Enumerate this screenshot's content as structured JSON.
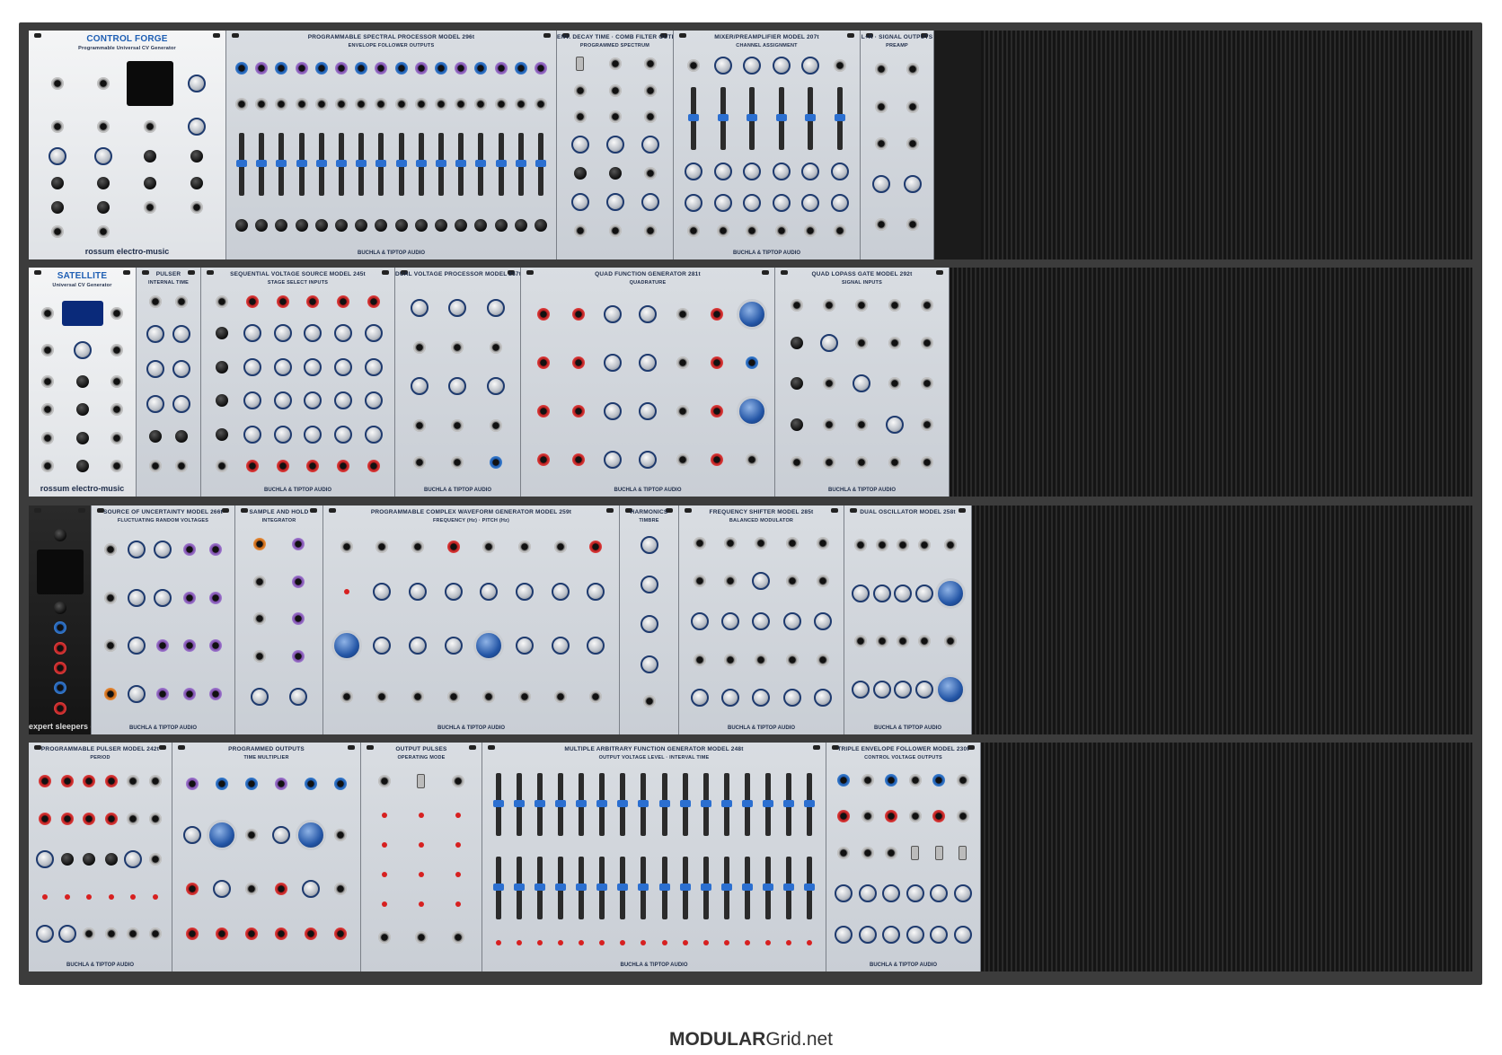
{
  "footer": {
    "brand_bold": "MODULAR",
    "brand_rest": "Grid.net"
  },
  "rows": [
    {
      "modules": [
        {
          "title": "CONTROL FORGE",
          "subtitle": "Programmable Universal CV Generator",
          "foot": "rossum electro-music",
          "style": "white",
          "cols": 4,
          "components": [
            "jack",
            "jack",
            "screen",
            "knob",
            "jack",
            "jack",
            "jack",
            "knob",
            "knob",
            "knob",
            "btn",
            "btn",
            "btn",
            "btn",
            "btn",
            "btn",
            "btn",
            "btn",
            "jack",
            "jack",
            "jack",
            "jack"
          ]
        },
        {
          "title": "PROGRAMMABLE SPECTRAL PROCESSOR MODEL 296t",
          "subtitle": "ENVELOPE FOLLOWER OUTPUTS",
          "foot": "BUCHLA & TIPTOP AUDIO",
          "style": "grey",
          "cols": 16,
          "components": [
            "jack.blue",
            "jack.purple",
            "jack.blue",
            "jack.purple",
            "jack.blue",
            "jack.purple",
            "jack.blue",
            "jack.purple",
            "jack.blue",
            "jack.purple",
            "jack.blue",
            "jack.purple",
            "jack.blue",
            "jack.purple",
            "jack.blue",
            "jack.purple",
            "jack",
            "jack",
            "jack",
            "jack",
            "jack",
            "jack",
            "jack",
            "jack",
            "jack",
            "jack",
            "jack",
            "jack",
            "jack",
            "jack",
            "jack",
            "jack",
            "slider",
            "slider",
            "slider",
            "slider",
            "slider",
            "slider",
            "slider",
            "slider",
            "slider",
            "slider",
            "slider",
            "slider",
            "slider",
            "slider",
            "slider",
            "slider",
            "btn",
            "btn",
            "btn",
            "btn",
            "btn",
            "btn",
            "btn",
            "btn",
            "btn",
            "btn",
            "btn",
            "btn",
            "btn",
            "btn",
            "btn",
            "btn"
          ]
        },
        {
          "title": "ENV. DECAY TIME · COMB FILTER OUTPUTS",
          "subtitle": "PROGRAMMED SPECTRUM",
          "foot": "",
          "style": "grey",
          "cols": 3,
          "components": [
            "sw",
            "jack",
            "jack",
            "jack",
            "jack",
            "jack",
            "jack",
            "jack",
            "jack",
            "knob",
            "knob",
            "knob",
            "btn",
            "btn",
            "jack",
            "knob",
            "knob",
            "knob",
            "jack",
            "jack",
            "jack"
          ]
        },
        {
          "title": "MIXER/PREAMPLIFIER MODEL 207t",
          "subtitle": "CHANNEL ASSIGNMENT",
          "foot": "BUCHLA & TIPTOP AUDIO",
          "style": "grey",
          "cols": 6,
          "components": [
            "jack",
            "knob",
            "knob",
            "knob",
            "knob",
            "jack",
            "slider",
            "slider",
            "slider",
            "slider",
            "slider",
            "slider",
            "knob",
            "knob",
            "knob",
            "knob",
            "knob",
            "knob",
            "knob",
            "knob",
            "knob",
            "knob",
            "knob",
            "knob",
            "jack",
            "jack",
            "jack",
            "jack",
            "jack",
            "jack"
          ]
        },
        {
          "title": "L+R · SIGNAL OUTPUTS",
          "subtitle": "PREAMP",
          "foot": "",
          "style": "grey",
          "cols": 2,
          "components": [
            "jack",
            "jack",
            "jack",
            "jack",
            "jack",
            "jack",
            "knob",
            "knob",
            "jack",
            "jack"
          ]
        }
      ]
    },
    {
      "modules": [
        {
          "title": "SATELLITE",
          "subtitle": "Universal CV Generator",
          "foot": "rossum electro-music",
          "style": "white",
          "cols": 3,
          "components": [
            "jack",
            "screen.small",
            "jack",
            "jack",
            "knob",
            "jack",
            "jack",
            "btn",
            "jack",
            "jack",
            "btn",
            "jack",
            "jack",
            "btn",
            "jack",
            "jack",
            "btn",
            "jack"
          ]
        },
        {
          "title": "PULSER",
          "subtitle": "INTERNAL TIME",
          "foot": "",
          "style": "grey",
          "cols": 2,
          "components": [
            "jack",
            "jack",
            "knob",
            "knob",
            "knob",
            "knob",
            "knob",
            "knob",
            "btn",
            "btn",
            "jack",
            "jack"
          ]
        },
        {
          "title": "SEQUENTIAL VOLTAGE SOURCE MODEL 245t",
          "subtitle": "STAGE SELECT INPUTS",
          "foot": "BUCHLA & TIPTOP AUDIO",
          "style": "grey",
          "cols": 6,
          "components": [
            "jack",
            "jack.red",
            "jack.red",
            "jack.red",
            "jack.red",
            "jack.red",
            "btn",
            "knob",
            "knob",
            "knob",
            "knob",
            "knob",
            "btn",
            "knob",
            "knob",
            "knob",
            "knob",
            "knob",
            "btn",
            "knob",
            "knob",
            "knob",
            "knob",
            "knob",
            "btn",
            "knob",
            "knob",
            "knob",
            "knob",
            "knob",
            "jack",
            "jack.red",
            "jack.red",
            "jack.red",
            "jack.red",
            "jack.red"
          ]
        },
        {
          "title": "DUAL VOLTAGE PROCESSOR MODEL 257t",
          "subtitle": "",
          "foot": "BUCHLA & TIPTOP AUDIO",
          "style": "grey",
          "cols": 3,
          "components": [
            "knob",
            "knob",
            "knob",
            "jack",
            "jack",
            "jack",
            "knob",
            "knob",
            "knob",
            "jack",
            "jack",
            "jack",
            "jack",
            "jack",
            "jack.blue"
          ]
        },
        {
          "title": "QUAD FUNCTION GENERATOR 281t",
          "subtitle": "QUADRATURE",
          "foot": "BUCHLA & TIPTOP AUDIO",
          "style": "grey",
          "cols": 7,
          "components": [
            "jack.red",
            "jack.red",
            "knob",
            "knob",
            "jack",
            "jack.red",
            "knob.big",
            "jack.red",
            "jack.red",
            "knob",
            "knob",
            "jack",
            "jack.red",
            "jack.blue",
            "jack.red",
            "jack.red",
            "knob",
            "knob",
            "jack",
            "jack.red",
            "knob.big",
            "jack.red",
            "jack.red",
            "knob",
            "knob",
            "jack",
            "jack.red",
            "jack"
          ]
        },
        {
          "title": "QUAD LOPASS GATE MODEL 292t",
          "subtitle": "SIGNAL INPUTS",
          "foot": "BUCHLA & TIPTOP AUDIO",
          "style": "grey",
          "cols": 5,
          "components": [
            "jack",
            "jack",
            "jack",
            "jack",
            "jack",
            "btn",
            "knob",
            "jack",
            "jack",
            "jack",
            "btn",
            "jack",
            "knob",
            "jack",
            "jack",
            "btn",
            "jack",
            "jack",
            "knob",
            "jack",
            "jack",
            "jack",
            "jack",
            "jack",
            "jack"
          ]
        }
      ]
    },
    {
      "modules": [
        {
          "title": "",
          "subtitle": "",
          "foot": "expert sleepers disting",
          "style": "dark",
          "cols": 1,
          "components": [
            "btn",
            "screen",
            "btn",
            "jack.blue",
            "jack.red",
            "jack.red",
            "jack.blue",
            "jack.red"
          ]
        },
        {
          "title": "SOURCE OF UNCERTAINTY MODEL 266t",
          "subtitle": "FLUCTUATING RANDOM VOLTAGES",
          "foot": "BUCHLA & TIPTOP AUDIO",
          "style": "grey",
          "cols": 5,
          "components": [
            "jack",
            "knob",
            "knob",
            "jack.purple",
            "jack.purple",
            "jack",
            "knob",
            "knob",
            "jack.purple",
            "jack.purple",
            "jack",
            "knob",
            "jack.purple",
            "jack.purple",
            "jack.purple",
            "jack.orange",
            "knob",
            "jack.purple",
            "jack.purple",
            "jack.purple"
          ]
        },
        {
          "title": "SAMPLE AND HOLD",
          "subtitle": "INTEGRATOR",
          "foot": "",
          "style": "grey",
          "cols": 2,
          "components": [
            "jack.orange",
            "jack.purple",
            "jack",
            "jack.purple",
            "jack",
            "jack.purple",
            "jack",
            "jack.purple",
            "knob",
            "knob"
          ]
        },
        {
          "title": "PROGRAMMABLE COMPLEX WAVEFORM GENERATOR MODEL 259t",
          "subtitle": "FREQUENCY (Hz) · PITCH (Hz)",
          "foot": "BUCHLA & TIPTOP AUDIO",
          "style": "grey",
          "cols": 8,
          "components": [
            "jack",
            "jack",
            "jack",
            "jack.red",
            "jack",
            "jack",
            "jack",
            "jack.red",
            "led",
            "knob",
            "knob",
            "knob",
            "knob",
            "knob",
            "knob",
            "knob",
            "knob.big",
            "knob",
            "knob",
            "knob",
            "knob.big",
            "knob",
            "knob",
            "knob",
            "jack",
            "jack",
            "jack",
            "jack",
            "jack",
            "jack",
            "jack",
            "jack"
          ]
        },
        {
          "title": "HARMONICS",
          "subtitle": "TIMBRE",
          "foot": "",
          "style": "grey",
          "cols": 1,
          "components": [
            "knob",
            "knob",
            "knob",
            "knob",
            "jack"
          ]
        },
        {
          "title": "FREQUENCY SHIFTER MODEL 285t",
          "subtitle": "BALANCED MODULATOR",
          "foot": "BUCHLA & TIPTOP AUDIO",
          "style": "grey",
          "cols": 5,
          "components": [
            "jack",
            "jack",
            "jack",
            "jack",
            "jack",
            "jack",
            "jack",
            "knob",
            "jack",
            "jack",
            "knob",
            "knob",
            "knob",
            "knob",
            "knob",
            "jack",
            "jack",
            "jack",
            "jack",
            "jack",
            "knob",
            "knob",
            "knob",
            "knob",
            "knob"
          ]
        },
        {
          "title": "DUAL OSCILLATOR MODEL 258t",
          "subtitle": "",
          "foot": "BUCHLA & TIPTOP AUDIO",
          "style": "grey",
          "cols": 5,
          "components": [
            "jack",
            "jack",
            "jack",
            "jack",
            "jack",
            "knob",
            "knob",
            "knob",
            "knob",
            "knob.big",
            "jack",
            "jack",
            "jack",
            "jack",
            "jack",
            "knob",
            "knob",
            "knob",
            "knob",
            "knob.big"
          ]
        }
      ]
    },
    {
      "modules": [
        {
          "title": "PROGRAMMABLE PULSER MODEL 242t",
          "subtitle": "PERIOD",
          "foot": "BUCHLA & TIPTOP AUDIO",
          "style": "grey",
          "cols": 6,
          "components": [
            "jack.red",
            "jack.red",
            "jack.red",
            "jack.red",
            "jack",
            "jack",
            "jack.red",
            "jack.red",
            "jack.red",
            "jack.red",
            "jack",
            "jack",
            "knob",
            "btn",
            "btn",
            "btn",
            "knob",
            "jack",
            "led",
            "led",
            "led",
            "led",
            "led",
            "led",
            "knob",
            "knob",
            "jack",
            "jack",
            "jack",
            "jack"
          ]
        },
        {
          "title": "PROGRAMMED OUTPUTS",
          "subtitle": "TIME MULTIPLIER",
          "foot": "",
          "style": "grey",
          "cols": 6,
          "components": [
            "jack.purple",
            "jack.blue",
            "jack.blue",
            "jack.purple",
            "jack.blue",
            "jack.blue",
            "knob",
            "knob.big",
            "jack",
            "knob",
            "knob.big",
            "jack",
            "jack.red",
            "knob",
            "jack",
            "jack.red",
            "knob",
            "jack",
            "jack.red",
            "jack.red",
            "jack.red",
            "jack.red",
            "jack.red",
            "jack.red"
          ]
        },
        {
          "title": "OUTPUT PULSES",
          "subtitle": "OPERATING MODE",
          "foot": "",
          "style": "grey",
          "cols": 3,
          "components": [
            "jack",
            "sw",
            "jack",
            "led",
            "led",
            "led",
            "led",
            "led",
            "led",
            "led",
            "led",
            "led",
            "led",
            "led",
            "led",
            "jack",
            "jack",
            "jack"
          ]
        },
        {
          "title": "MULTIPLE ARBITRARY FUNCTION GENERATOR MODEL 248t",
          "subtitle": "OUTPUT VOLTAGE LEVEL · INTERVAL TIME",
          "foot": "BUCHLA & TIPTOP AUDIO",
          "style": "grey",
          "cols": 16,
          "components": [
            "slider",
            "slider",
            "slider",
            "slider",
            "slider",
            "slider",
            "slider",
            "slider",
            "slider",
            "slider",
            "slider",
            "slider",
            "slider",
            "slider",
            "slider",
            "slider",
            "slider",
            "slider",
            "slider",
            "slider",
            "slider",
            "slider",
            "slider",
            "slider",
            "slider",
            "slider",
            "slider",
            "slider",
            "slider",
            "slider",
            "slider",
            "slider",
            "led",
            "led",
            "led",
            "led",
            "led",
            "led",
            "led",
            "led",
            "led",
            "led",
            "led",
            "led",
            "led",
            "led",
            "led",
            "led"
          ]
        },
        {
          "title": "TRIPLE ENVELOPE FOLLOWER MODEL 230t",
          "subtitle": "CONTROL VOLTAGE OUTPUTS",
          "foot": "BUCHLA & TIPTOP AUDIO",
          "style": "grey",
          "cols": 6,
          "components": [
            "jack.blue",
            "jack",
            "jack.blue",
            "jack",
            "jack.blue",
            "jack",
            "jack.red",
            "jack",
            "jack.red",
            "jack",
            "jack.red",
            "jack",
            "jack",
            "jack",
            "jack",
            "sw",
            "sw",
            "sw",
            "knob",
            "knob",
            "knob",
            "knob",
            "knob",
            "knob",
            "knob",
            "knob",
            "knob",
            "knob",
            "knob",
            "knob"
          ]
        }
      ]
    }
  ]
}
